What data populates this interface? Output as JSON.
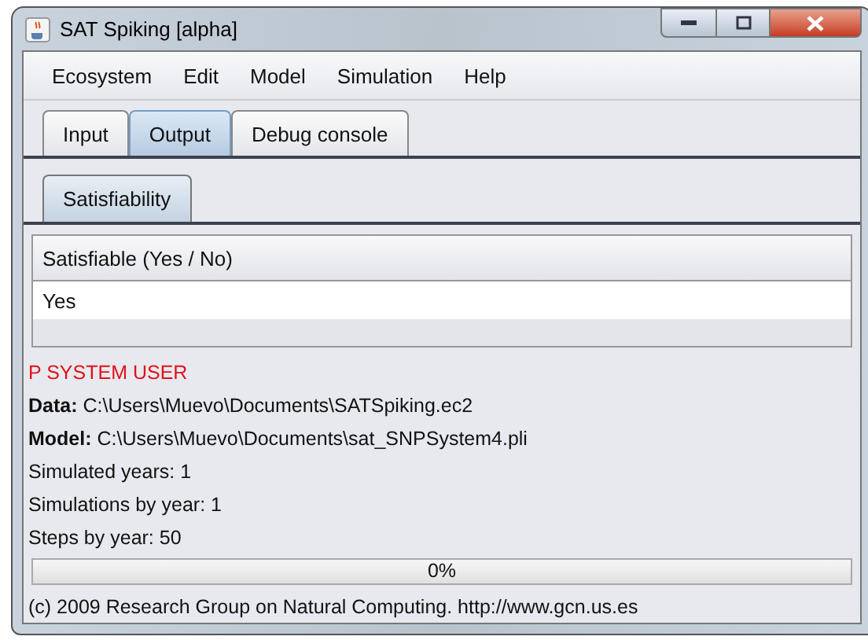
{
  "window": {
    "title": "SAT Spiking [alpha]"
  },
  "menu": [
    "Ecosystem",
    "Edit",
    "Model",
    "Simulation",
    "Help"
  ],
  "tabs": [
    {
      "label": "Input",
      "selected": false
    },
    {
      "label": "Output",
      "selected": true
    },
    {
      "label": "Debug console",
      "selected": false
    }
  ],
  "subtabs": [
    {
      "label": "Satisfiability",
      "selected": true
    }
  ],
  "table": {
    "columns": [
      "Satisfiable (Yes / No)"
    ],
    "rows": [
      [
        "Yes"
      ]
    ]
  },
  "log": {
    "heading": "P SYSTEM USER",
    "lines": [
      "**Data:** C:\\Users\\Muevo\\Documents\\SATSpiking.ec2",
      "**Model:** C:\\Users\\Muevo\\Documents\\sat_SNPSystem4.pli",
      "Simulated years: 1",
      "Simulations by year: 1",
      "Steps by year: 50"
    ]
  },
  "progress": {
    "level": 0,
    "reading": "0%"
  },
  "status_bar": "(c) 2009 Research Group on Natural Computing. http://www.gcn.us.es"
}
